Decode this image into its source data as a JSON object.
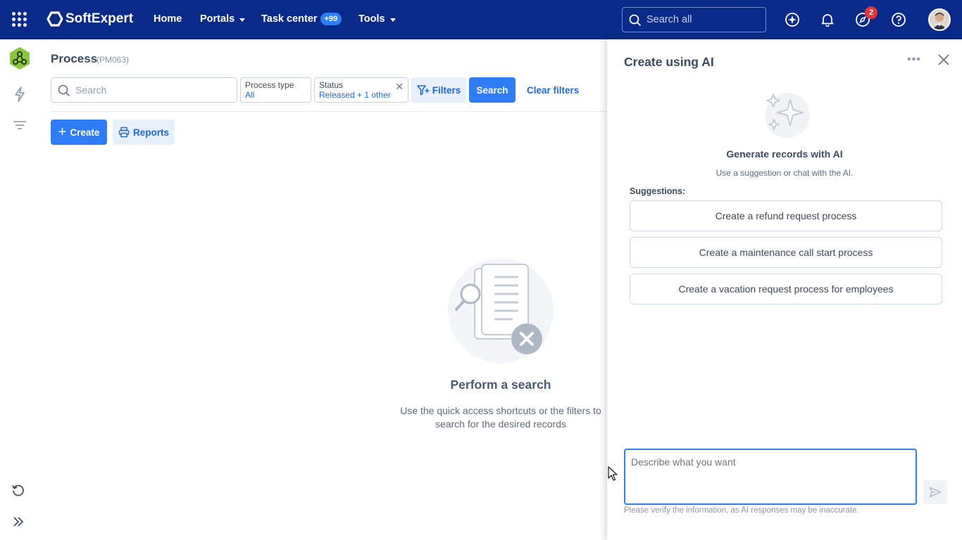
{
  "topbar": {
    "brand": "SoftExpert",
    "nav": {
      "home": "Home",
      "portals": "Portals",
      "task_center": "Task center",
      "task_badge": "+99",
      "tools": "Tools"
    },
    "search_placeholder": "Search all",
    "notification_count": "2",
    "icons": [
      "apps-grid-icon",
      "ai-sparkle-icon",
      "bell-icon",
      "compass-icon",
      "help-icon"
    ]
  },
  "rail": {
    "icons": [
      "process-module-icon",
      "lightning-icon",
      "filter-lines-icon",
      "history-icon",
      "expand-icon"
    ]
  },
  "main": {
    "title": "Process",
    "code": "(PM063)",
    "search_placeholder": "Search",
    "filters": [
      {
        "label": "Process type",
        "value": "All"
      },
      {
        "label": "Status",
        "value": "Released + 1 other"
      }
    ],
    "filters_button": "Filters",
    "search_button": "Search",
    "clear_filters": "Clear filters",
    "create_button": "Create",
    "reports_button": "Reports",
    "empty_state": {
      "title": "Perform a search",
      "text": "Use the quick access shortcuts or the filters to search for the desired records"
    }
  },
  "ai_panel": {
    "title": "Create using AI",
    "heading": "Generate records with AI",
    "subheading": "Use a suggestion or chat with the AI.",
    "suggestions_label": "Suggestions:",
    "suggestions": [
      "Create a refund request process",
      "Create a maintenance call start process",
      "Create a vacation request process for employees"
    ],
    "prompt_placeholder": "Describe what you want",
    "disclaimer": "Please verify the information, as AI responses may be inaccurate."
  },
  "colors": {
    "topbar": "#0a2a8a",
    "primary": "#2e7cf6",
    "link": "#1f66d9",
    "badge_red": "#e5343a",
    "module_green": "#8cc63f"
  }
}
